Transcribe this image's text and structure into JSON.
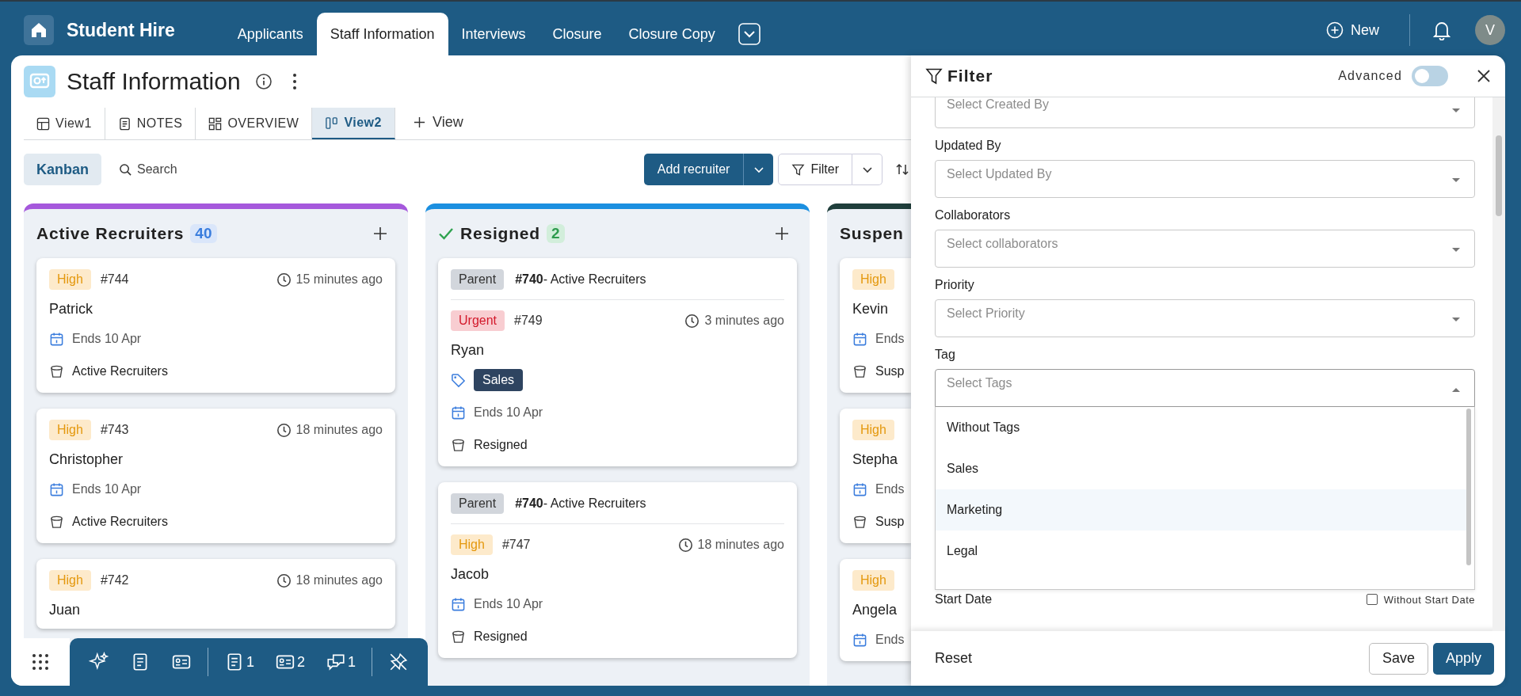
{
  "app": {
    "title": "Student Hire",
    "tabs": [
      {
        "label": "Applicants",
        "selected": false
      },
      {
        "label": "Staff Information",
        "selected": true
      },
      {
        "label": "Interviews",
        "selected": false
      },
      {
        "label": "Closure",
        "selected": false
      },
      {
        "label": "Closure Copy",
        "selected": false
      }
    ],
    "new_label": "New",
    "avatar": "V"
  },
  "board": {
    "title": "Staff Information",
    "view_tabs": [
      {
        "label": "View1",
        "kind": "table",
        "selected": false
      },
      {
        "label": "NOTES",
        "kind": "notes",
        "selected": false
      },
      {
        "label": "OVERVIEW",
        "kind": "overview",
        "selected": false
      },
      {
        "label": "View2",
        "kind": "kanban",
        "selected": true
      }
    ],
    "add_view": "View",
    "toolbar": {
      "layout": "Kanban",
      "search": "Search",
      "add": "Add recruiter",
      "filter": "Filter"
    }
  },
  "columns": [
    {
      "title": "Active Recruiters",
      "count": "40",
      "color": "#a558dc",
      "done": false,
      "cards": [
        {
          "priority": {
            "label": "High",
            "kind": "high"
          },
          "id": "#744",
          "time": "15 minutes ago",
          "name": "Patrick",
          "due": "Ends 10 Apr",
          "stage": "Active Recruiters"
        },
        {
          "priority": {
            "label": "High",
            "kind": "high"
          },
          "id": "#743",
          "time": "18 minutes ago",
          "name": "Christopher",
          "due": "Ends 10 Apr",
          "stage": "Active Recruiters"
        },
        {
          "priority": {
            "label": "High",
            "kind": "high"
          },
          "id": "#742",
          "time": "18 minutes ago",
          "name": "Juan"
        }
      ]
    },
    {
      "title": "Resigned",
      "count": "2",
      "color": "#1b8fe0",
      "done": true,
      "cards": [
        {
          "parent": {
            "label": "Parent",
            "text": "**#740**- Active Recruiters"
          },
          "priority": {
            "label": "Urgent",
            "kind": "urgent"
          },
          "id": "#749",
          "time": "3 minutes ago",
          "name": "Ryan",
          "tag": "Sales",
          "due": "Ends 10 Apr",
          "stage": "Resigned"
        },
        {
          "parent": {
            "label": "Parent",
            "text": "**#740**- Active Recruiters"
          },
          "priority": {
            "label": "High",
            "kind": "high"
          },
          "id": "#747",
          "time": "18 minutes ago",
          "name": "Jacob",
          "due": "Ends 10 Apr",
          "stage": "Resigned"
        }
      ]
    },
    {
      "title": "Suspen",
      "color": "#1f3e3b",
      "done": false,
      "cards": [
        {
          "priority": {
            "label": "High",
            "kind": "high"
          },
          "name": "Kevin",
          "due": "Ends",
          "stage": "Susp"
        },
        {
          "priority": {
            "label": "High",
            "kind": "high"
          },
          "name": "Stepha",
          "due": "Ends",
          "stage": "Susp"
        },
        {
          "priority": {
            "label": "High",
            "kind": "high"
          },
          "name": "Angela",
          "due": "Ends"
        }
      ]
    }
  ],
  "bottom_bar": {
    "groups": [
      [
        {
          "kind": "sparkle"
        },
        {
          "kind": "doc"
        },
        {
          "kind": "card"
        }
      ],
      [
        {
          "kind": "doc",
          "count": "1"
        },
        {
          "kind": "card",
          "count": "2"
        },
        {
          "kind": "chat",
          "count": "1"
        }
      ],
      [
        {
          "kind": "unpin"
        }
      ]
    ]
  },
  "filter": {
    "title": "Filter",
    "advanced_label": "Advanced",
    "advanced_on": false,
    "fields": [
      {
        "placeholder": "Select Created By",
        "open": false
      },
      {
        "label": "Updated By",
        "placeholder": "Select Updated By",
        "open": false
      },
      {
        "label": "Collaborators",
        "placeholder": "Select collaborators",
        "open": false
      },
      {
        "label": "Priority",
        "placeholder": "Select Priority",
        "open": false
      },
      {
        "label": "Tag",
        "placeholder": "Select Tags",
        "open": true,
        "options": [
          {
            "label": "Without Tags",
            "highlighted": false
          },
          {
            "label": "Sales",
            "highlighted": false
          },
          {
            "label": "Marketing",
            "highlighted": true
          },
          {
            "label": "Legal",
            "highlighted": false
          }
        ]
      }
    ],
    "start_date": {
      "label": "Start Date",
      "checkbox_label": "Without Start Date",
      "checked": false
    },
    "reset": "Reset",
    "save": "Save",
    "apply": "Apply"
  }
}
